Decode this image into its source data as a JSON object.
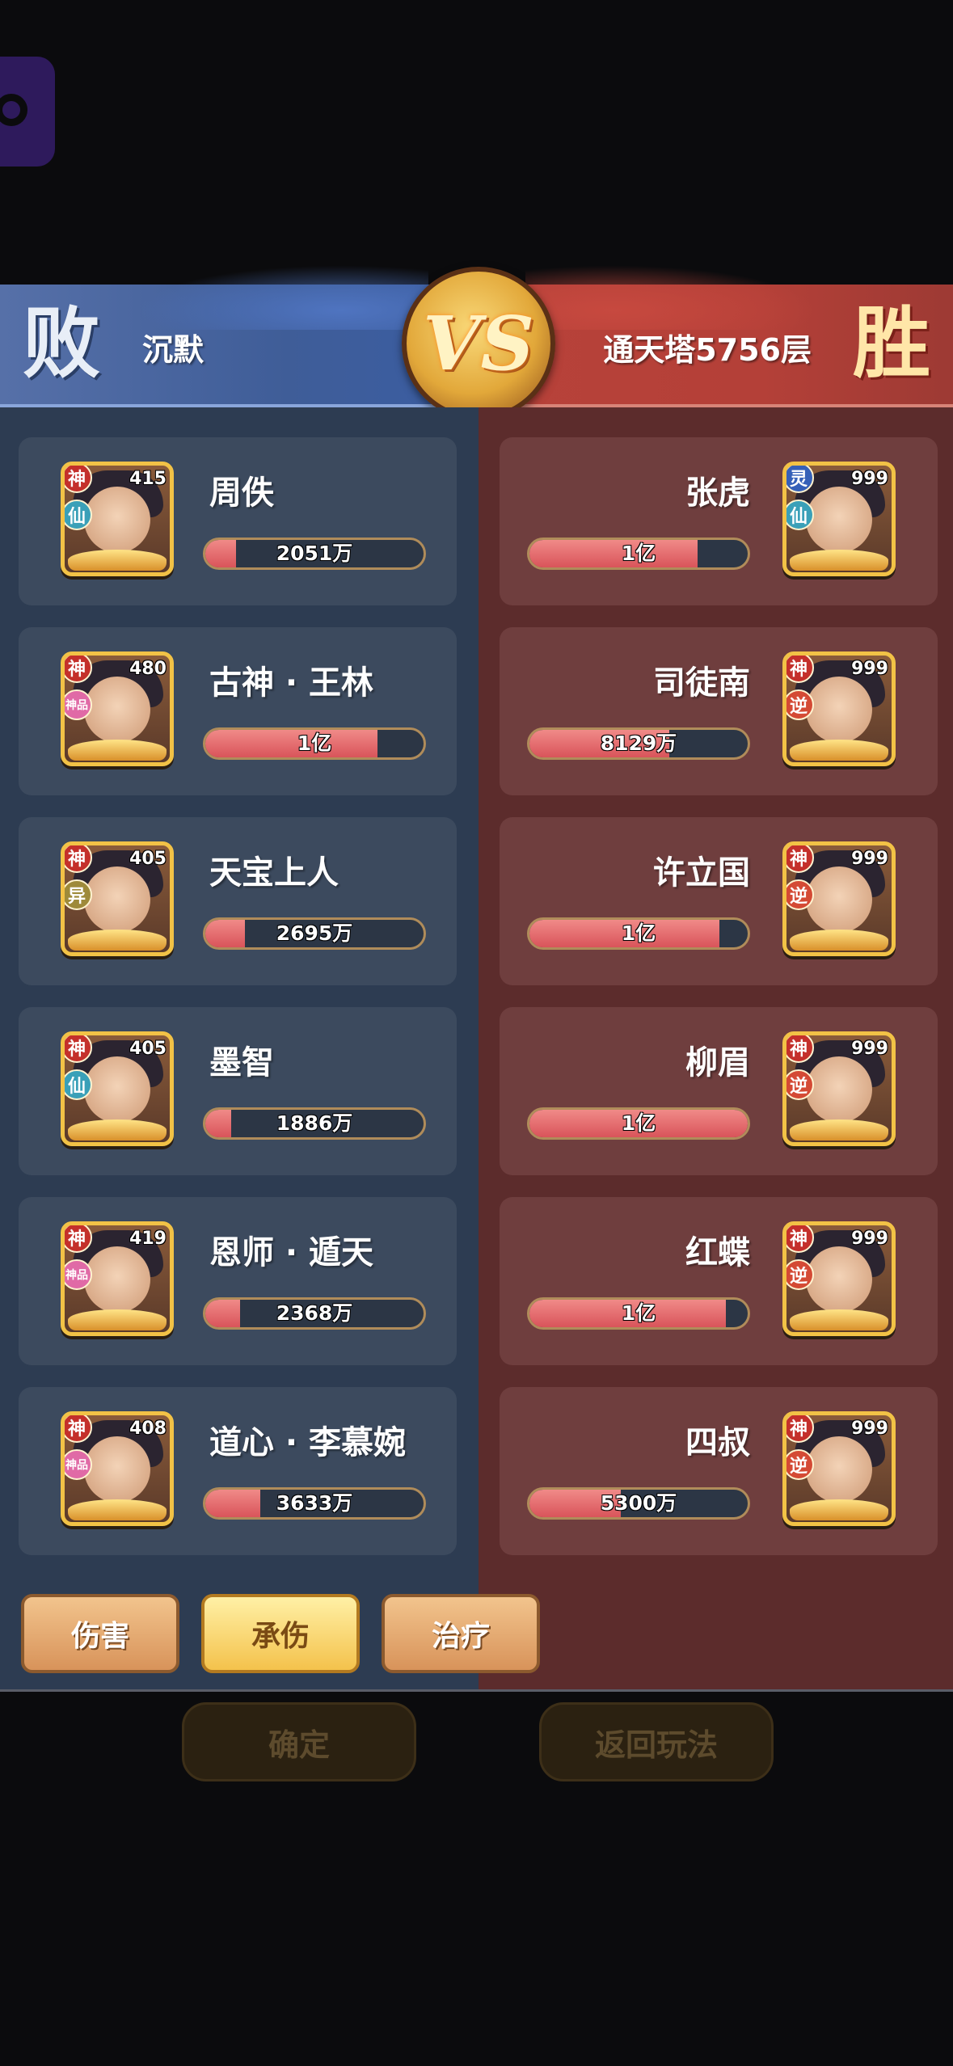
{
  "banner": {
    "result_left": "败",
    "player_left": "沉默",
    "vs": "VS",
    "player_right": "通天塔5756层",
    "result_right": "胜"
  },
  "left_team": [
    {
      "name": "周佚",
      "level": "415",
      "badge1": "神",
      "badge2": "仙",
      "value": "2051万",
      "fill": 0.14
    },
    {
      "name": "古神 · 王林",
      "level": "480",
      "badge1": "神",
      "badge2": "神品",
      "value": "1亿",
      "fill": 0.79
    },
    {
      "name": "天宝上人",
      "level": "405",
      "badge1": "神",
      "badge2": "异",
      "value": "2695万",
      "fill": 0.18
    },
    {
      "name": "墨智",
      "level": "405",
      "badge1": "神",
      "badge2": "仙",
      "value": "1886万",
      "fill": 0.12
    },
    {
      "name": "恩师 · 遁天",
      "level": "419",
      "badge1": "神",
      "badge2": "神品",
      "value": "2368万",
      "fill": 0.16
    },
    {
      "name": "道心 · 李慕婉",
      "level": "408",
      "badge1": "神",
      "badge2": "神品",
      "value": "3633万",
      "fill": 0.25
    }
  ],
  "right_team": [
    {
      "name": "张虎",
      "level": "999",
      "badge1": "灵",
      "badge2": "仙",
      "value": "1亿",
      "fill": 0.77
    },
    {
      "name": "司徒南",
      "level": "999",
      "badge1": "神",
      "badge2": "逆",
      "value": "8129万",
      "fill": 0.64
    },
    {
      "name": "许立国",
      "level": "999",
      "badge1": "神",
      "badge2": "逆",
      "value": "1亿",
      "fill": 0.87
    },
    {
      "name": "柳眉",
      "level": "999",
      "badge1": "神",
      "badge2": "逆",
      "value": "1亿",
      "fill": 1.0
    },
    {
      "name": "红蝶",
      "level": "999",
      "badge1": "神",
      "badge2": "逆",
      "value": "1亿",
      "fill": 0.9
    },
    {
      "name": "四叔",
      "level": "999",
      "badge1": "神",
      "badge2": "逆",
      "value": "5300万",
      "fill": 0.42
    }
  ],
  "tabs": [
    {
      "label": "伤害",
      "active": false
    },
    {
      "label": "承伤",
      "active": true
    },
    {
      "label": "治疗",
      "active": false
    }
  ],
  "buttons": {
    "confirm": "确定",
    "back": "返回玩法"
  }
}
